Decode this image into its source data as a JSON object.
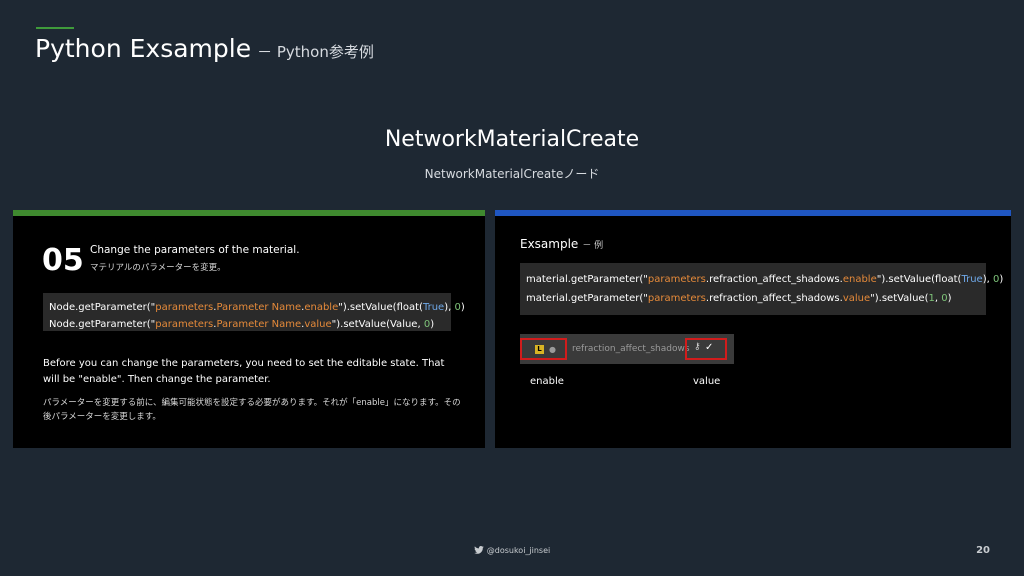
{
  "header": {
    "title": "Python Exsample",
    "subtitle": "－ Python参考例"
  },
  "section": {
    "title": "NetworkMaterialCreate",
    "subtitle": "NetworkMaterialCreateノード"
  },
  "left_panel": {
    "step_number": "05",
    "step_title": "Change the parameters of the material.",
    "step_subtitle": "マテリアルのパラメーターを変更。",
    "code_lines": [
      {
        "p1": "Node.getParameter(\"",
        "s1": "parameters",
        "p2": ".",
        "s2": "Parameter Name",
        "p3": ".",
        "s3": "enable",
        "p4": "\").setValue(float(",
        "k1": "True",
        "p5": "), ",
        "n1": "0",
        "p6": ")"
      },
      {
        "p1": "Node.getParameter(\"",
        "s1": "parameters",
        "p2": ".",
        "s2": "Parameter Name",
        "p3": ".",
        "s3": "value",
        "p4": "\").setValue(Value, ",
        "n1": "0",
        "p5": ")"
      }
    ],
    "desc_en": "Before you can change the parameters, you need to set the editable state. That will be \"enable\". Then change the parameter.",
    "desc_jp": "パラメーターを変更する前に、編集可能状態を設定する必要があります。それが「enable」になります。その後パラメーターを変更します。"
  },
  "right_panel": {
    "title": "Exsample",
    "title_sub": "－ 例",
    "code_lines": [
      {
        "p1": "material.getParameter(\"",
        "s1": "parameters",
        "p2": ".refraction_affect_shadows.",
        "s2": "enable",
        "p3": "\").setValue(float(",
        "k1": "True",
        "p4": "), ",
        "n1": "0",
        "p5": ")"
      },
      {
        "p1": "material.getParameter(\"",
        "s1": "parameters",
        "p2": ".refraction_affect_shadows.",
        "s2": "value",
        "p3": "\").setValue(",
        "n1": "1",
        "p4": ", ",
        "n2": "0",
        "p5": ")"
      }
    ],
    "param_widget": {
      "lock_label": "L",
      "dot": "●",
      "name": "refraction_affect_shadows",
      "key_symbol": "⚷",
      "check_symbol": "✓"
    },
    "label_enable": "enable",
    "label_value": "value"
  },
  "footer": {
    "handle": "@dosukoi_jinsei",
    "page_number": "20"
  },
  "colors": {
    "background": "#1e2833",
    "accent_green": "#3f8a2f",
    "accent_blue": "#1f56c2",
    "string_orange": "#e58a3a",
    "number_green": "#7fc57a",
    "keyword_blue": "#6fa8e8",
    "highlight_red": "#d11c1c"
  }
}
